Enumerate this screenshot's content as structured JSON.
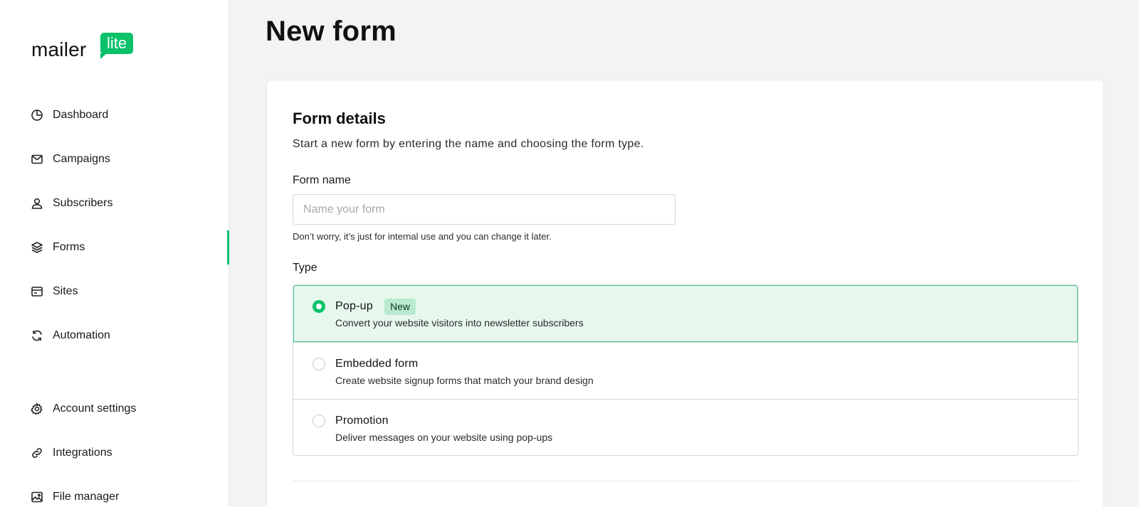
{
  "brand": {
    "word": "mailer",
    "bubble": "lite",
    "accent": "#09c269"
  },
  "sidebar": {
    "items": [
      {
        "label": "Dashboard",
        "icon": "pie-chart-icon"
      },
      {
        "label": "Campaigns",
        "icon": "envelope-icon"
      },
      {
        "label": "Subscribers",
        "icon": "user-icon"
      },
      {
        "label": "Forms",
        "icon": "layers-icon",
        "active": true
      },
      {
        "label": "Sites",
        "icon": "browser-icon"
      },
      {
        "label": "Automation",
        "icon": "refresh-icon"
      },
      {
        "label": "Account settings",
        "icon": "gear-icon"
      },
      {
        "label": "Integrations",
        "icon": "link-icon"
      },
      {
        "label": "File manager",
        "icon": "image-icon"
      }
    ]
  },
  "main": {
    "title": "New form",
    "section": {
      "title": "Form details",
      "description": "Start a new form by entering the name and choosing the form type.",
      "name_label": "Form name",
      "name_placeholder": "Name your form",
      "name_value": "",
      "hint": "Don’t worry, it’s just for internal use and you can change it later.",
      "type_label": "Type",
      "types": [
        {
          "title": "Pop-up",
          "badge": "New",
          "description": "Convert your website visitors into newsletter subscribers",
          "selected": true
        },
        {
          "title": "Embedded form",
          "description": "Create website signup forms that match your brand design",
          "selected": false
        },
        {
          "title": "Promotion",
          "description": "Deliver messages on your website using pop-ups",
          "selected": false
        }
      ]
    }
  }
}
